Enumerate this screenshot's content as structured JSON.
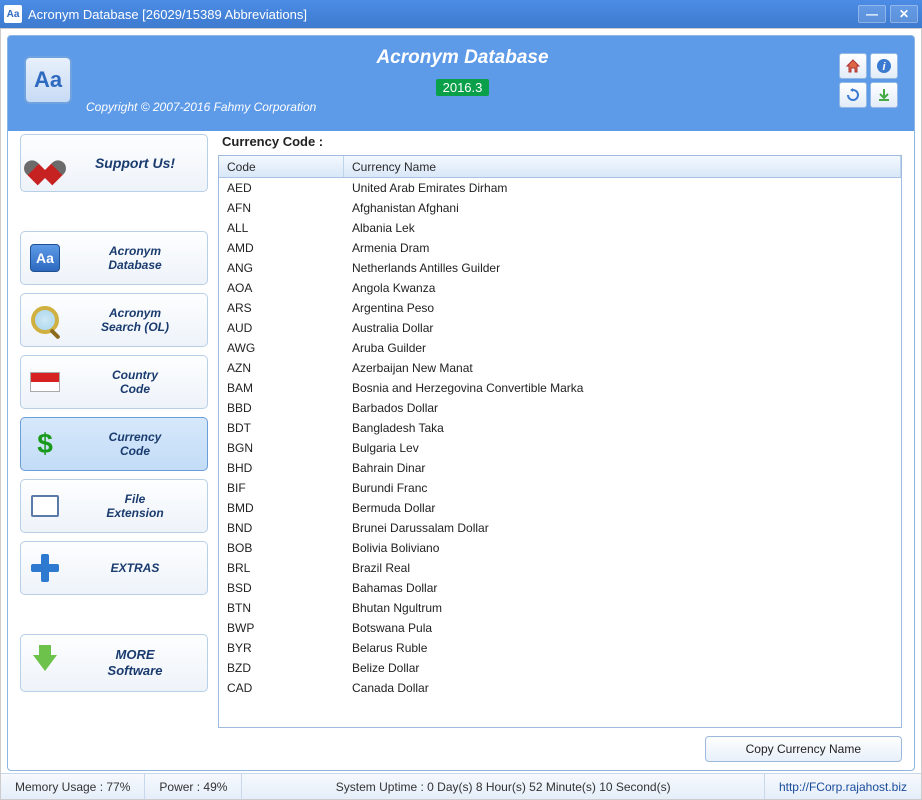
{
  "titlebar": {
    "title": "Acronym Database [26029/15389 Abbreviations]"
  },
  "header": {
    "app_name": "Acronym Database",
    "version_badge": "2016.3",
    "copyright": "Copyright © 2007-2016 Fahmy Corporation"
  },
  "sidebar": {
    "support": "Support Us!",
    "items": [
      {
        "label": "Acronym\nDatabase"
      },
      {
        "label": "Acronym\nSearch (OL)"
      },
      {
        "label": "Country\nCode"
      },
      {
        "label": "Currency\nCode"
      },
      {
        "label": "File\nExtension"
      },
      {
        "label": "EXTRAS"
      }
    ],
    "more": "MORE\nSoftware"
  },
  "main": {
    "heading": "Currency Code :",
    "col_code": "Code",
    "col_name": "Currency Name",
    "copy_btn": "Copy Currency Name",
    "rows": [
      {
        "code": "AED",
        "name": "United Arab Emirates Dirham"
      },
      {
        "code": "AFN",
        "name": "Afghanistan Afghani"
      },
      {
        "code": "ALL",
        "name": "Albania Lek"
      },
      {
        "code": "AMD",
        "name": "Armenia Dram"
      },
      {
        "code": "ANG",
        "name": "Netherlands Antilles Guilder"
      },
      {
        "code": "AOA",
        "name": "Angola Kwanza"
      },
      {
        "code": "ARS",
        "name": "Argentina Peso"
      },
      {
        "code": "AUD",
        "name": "Australia Dollar"
      },
      {
        "code": "AWG",
        "name": "Aruba Guilder"
      },
      {
        "code": "AZN",
        "name": "Azerbaijan New Manat"
      },
      {
        "code": "BAM",
        "name": "Bosnia and Herzegovina Convertible Marka"
      },
      {
        "code": "BBD",
        "name": "Barbados Dollar"
      },
      {
        "code": "BDT",
        "name": "Bangladesh Taka"
      },
      {
        "code": "BGN",
        "name": "Bulgaria Lev"
      },
      {
        "code": "BHD",
        "name": "Bahrain Dinar"
      },
      {
        "code": "BIF",
        "name": "Burundi Franc"
      },
      {
        "code": "BMD",
        "name": "Bermuda Dollar"
      },
      {
        "code": "BND",
        "name": "Brunei Darussalam Dollar"
      },
      {
        "code": "BOB",
        "name": "Bolivia Boliviano"
      },
      {
        "code": "BRL",
        "name": "Brazil Real"
      },
      {
        "code": "BSD",
        "name": "Bahamas Dollar"
      },
      {
        "code": "BTN",
        "name": "Bhutan Ngultrum"
      },
      {
        "code": "BWP",
        "name": "Botswana Pula"
      },
      {
        "code": "BYR",
        "name": "Belarus Ruble"
      },
      {
        "code": "BZD",
        "name": "Belize Dollar"
      },
      {
        "code": "CAD",
        "name": "Canada Dollar"
      }
    ]
  },
  "status": {
    "memory": "Memory Usage : 77%",
    "power": "Power : 49%",
    "uptime": "System Uptime : 0 Day(s) 8 Hour(s) 52 Minute(s) 10 Second(s)",
    "url": "http://FCorp.rajahost.biz"
  }
}
